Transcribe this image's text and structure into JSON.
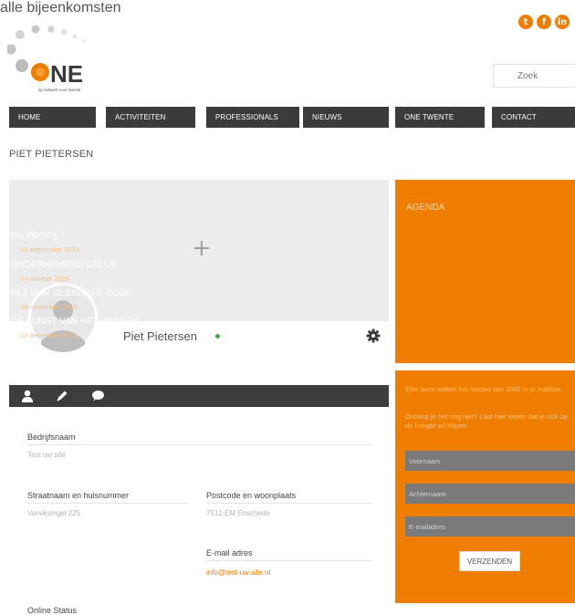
{
  "brand": {
    "name": "ONE",
    "tagline": "zp netwerk voor twente",
    "accent_color": "#ef7d00"
  },
  "social": [
    {
      "name": "twitter-icon",
      "glyph": "t"
    },
    {
      "name": "facebook-icon",
      "glyph": "f"
    },
    {
      "name": "linkedin-icon",
      "glyph": "in"
    }
  ],
  "search": {
    "placeholder": "Zoek"
  },
  "nav": {
    "items": [
      "HOME",
      "ACTIVITEITEN",
      "PROFESSIONALS",
      "NIEUWS",
      "ONE TWENTE",
      "CONTACT"
    ]
  },
  "page": {
    "title": "PIET PIETERSEN"
  },
  "profile": {
    "name": "Piet Pietersen",
    "status_color": "#47a447",
    "cover_icon": "plus-icon",
    "tabs": [
      "user-icon",
      "pencil-icon",
      "comment-icon"
    ],
    "fields": {
      "company_label": "Bedrijfsnaam",
      "company_value": "Test uw site",
      "street_label": "Straatnaam en huisnummer",
      "street_value": "Varviksingel 225",
      "postcode_label": "Postcode en woonplaats",
      "postcode_value": "7512 EM Enschede",
      "email_label": "E-mail adres",
      "email_value": "info@test-uw-site.nl",
      "online_label": "Online Status"
    }
  },
  "agenda": {
    "heading": "AGENDA",
    "events": [
      {
        "title": "EN PROFIL",
        "date": "15 september 2015"
      },
      {
        "title": "ONDERNEMEND GELUK",
        "date": "14 oktober 2015"
      },
      {
        "title": "IN 2 UUR JE EIGEN E-BOOK",
        "date": "18 november 2015"
      },
      {
        "title": "DE KUNST VAN HET VRAGEN",
        "date": "14 december 2015"
      }
    ],
    "all_link": "alle bijeenkomsten"
  },
  "newsletter": {
    "text1": "Elke twee weken het nieuws van ONE in je mailbox",
    "text2": "Ontving je het nog niet? Laat hier weten dat je ook op de hoogte wil blijven",
    "firstname_placeholder": "Voornaam",
    "lastname_placeholder": "Achternaam",
    "email_placeholder": "E-mailadres",
    "submit_label": "VERZENDEN"
  }
}
